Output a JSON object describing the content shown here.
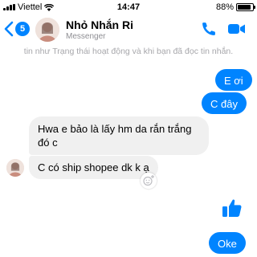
{
  "status_bar": {
    "carrier": "Viettel",
    "time": "14:47",
    "battery_text": "88%",
    "battery_level": 0.88
  },
  "header": {
    "title": "Nhỏ Nhắn Ri",
    "subtitle": "Messenger",
    "back_badge": "5",
    "accent_color": "#0084ff"
  },
  "read_notice": "tin như Trạng thái hoạt động và khi bạn đã đọc tin nhắn.",
  "messages": [
    {
      "side": "out",
      "text": "E ơi"
    },
    {
      "side": "out",
      "text": "C đây"
    },
    {
      "side": "in",
      "text": "Hwa e bảo là lấy hm da rắn trắng đó c"
    },
    {
      "side": "in",
      "text": "C có ship shopee dk k ạ"
    },
    {
      "side": "out",
      "icon": "thumbs-up-icon"
    },
    {
      "side": "out",
      "text": "Oke"
    }
  ]
}
